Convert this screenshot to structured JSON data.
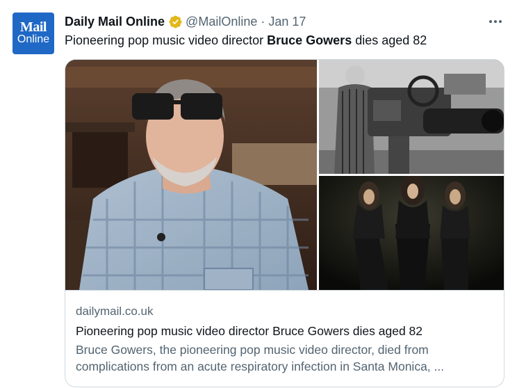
{
  "avatar": {
    "logo_top": "Mail",
    "logo_bottom": "Online",
    "color": "#1f68c6"
  },
  "header": {
    "display_name": "Daily Mail Online",
    "verified_icon": "verified-gold-badge-icon",
    "handle": "@MailOnline",
    "separator": "·",
    "date": "Jan 17",
    "more_icon": "more-horizontal-icon"
  },
  "tweet": {
    "text_before": "Pioneering pop music video director ",
    "text_bold": "Bruce Gowers",
    "text_after": " dies aged 82"
  },
  "card": {
    "domain": "dailymail.co.uk",
    "title": "Pioneering pop music video director Bruce Gowers dies aged 82",
    "desc_line1": "Bruce Gowers, the pioneering pop music video director, died from",
    "desc_line2": "complications from an acute respiratory infection in Santa Monica, ...",
    "images": [
      "portrait-photo",
      "vintage-camera-photo",
      "band-photo"
    ]
  },
  "colors": {
    "text_primary": "#0f1419",
    "text_secondary": "#536471",
    "border": "#cfd9de",
    "verified_gold": "#e2b719"
  }
}
